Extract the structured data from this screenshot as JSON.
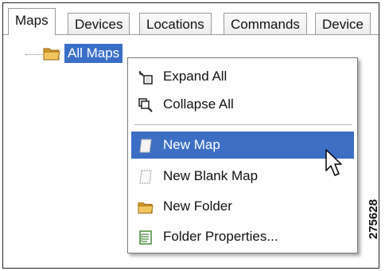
{
  "tabs": [
    {
      "label": "Maps",
      "active": true
    },
    {
      "label": "Devices",
      "active": false
    },
    {
      "label": "Locations",
      "active": false
    },
    {
      "label": "Commands",
      "active": false
    },
    {
      "label": "Device",
      "active": false
    }
  ],
  "tree": {
    "root_label": "All Maps",
    "root_icon": "folder-icon"
  },
  "context_menu": {
    "items": [
      {
        "label": "Expand All",
        "icon": "expand-all-icon"
      },
      {
        "label": "Collapse All",
        "icon": "collapse-all-icon"
      },
      {
        "label": "New Map",
        "icon": "new-map-icon",
        "highlighted": true
      },
      {
        "label": "New Blank Map",
        "icon": "new-blank-map-icon"
      },
      {
        "label": "New Folder",
        "icon": "folder-icon"
      },
      {
        "label": "Folder Properties...",
        "icon": "folder-properties-icon"
      }
    ]
  },
  "figure_id": "275628",
  "colors": {
    "selection": "#3a6fc8",
    "menu_highlight": "#3c6fc4",
    "folder": "#e8a93a"
  }
}
